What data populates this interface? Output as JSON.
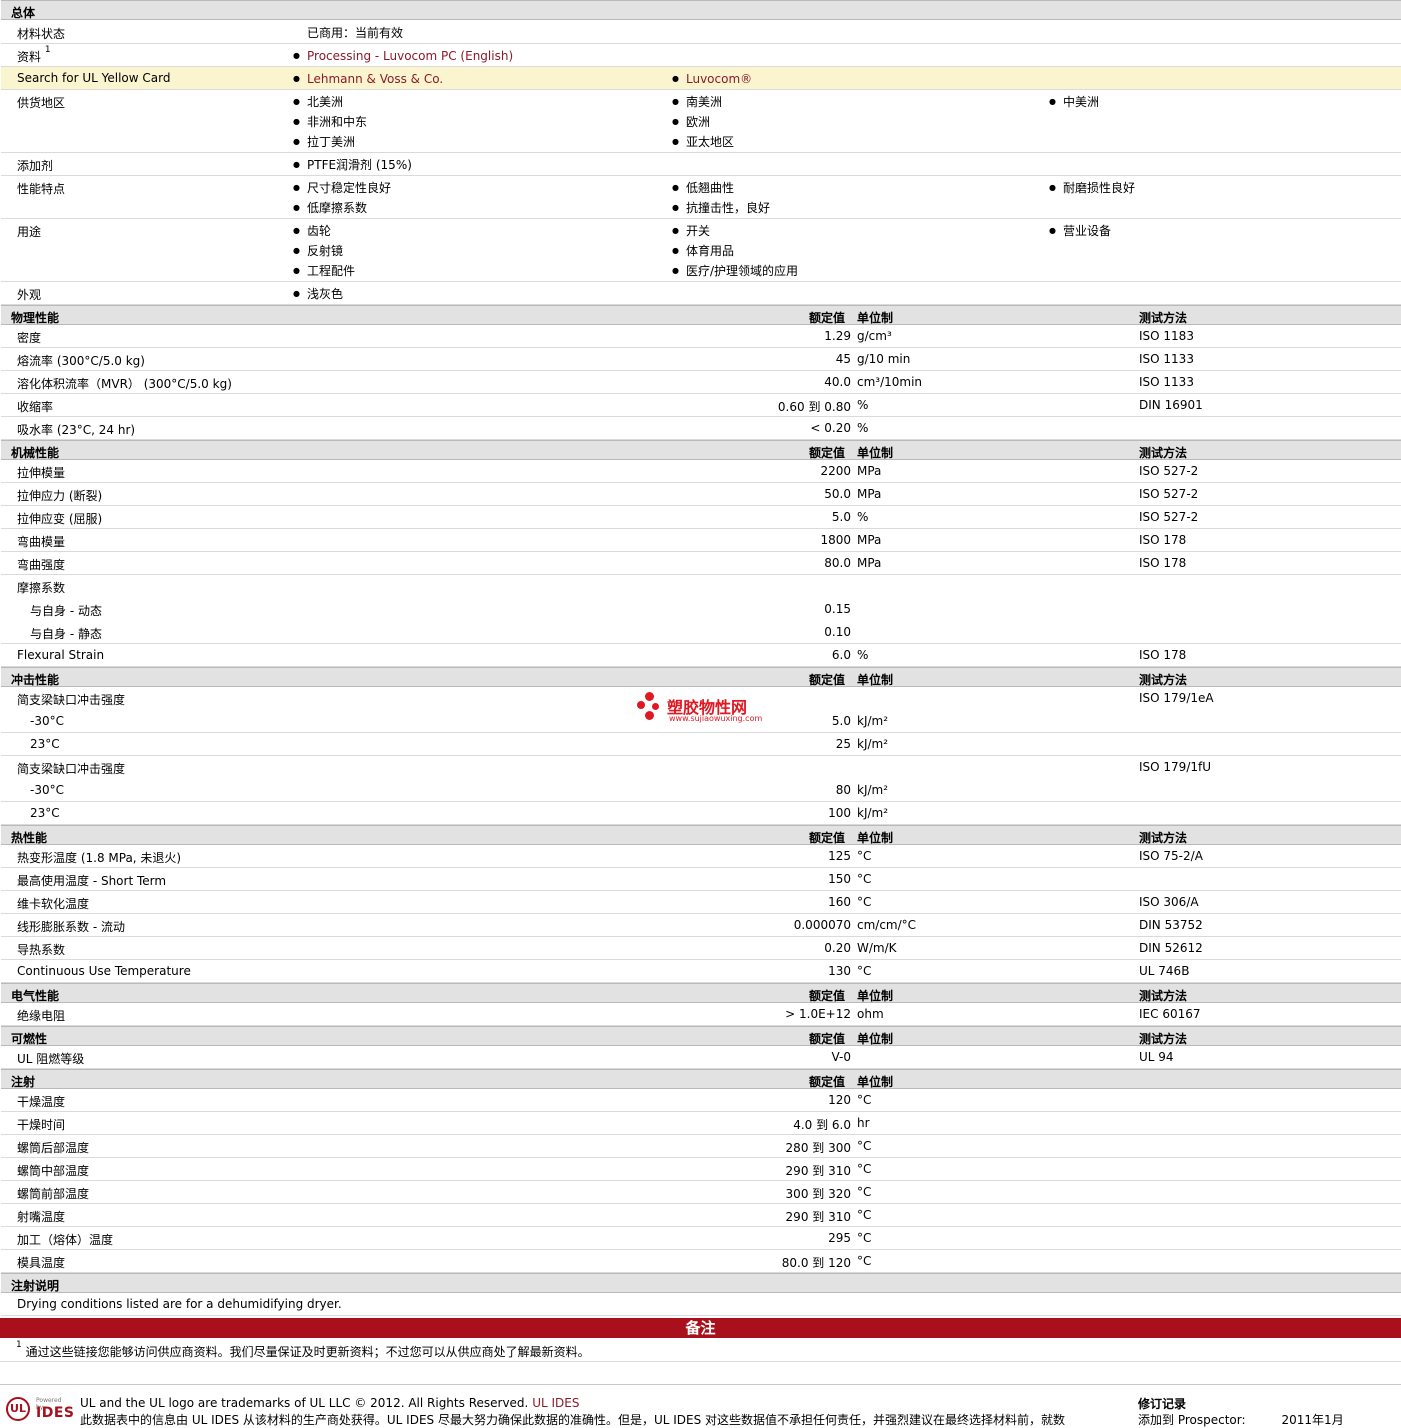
{
  "general": {
    "title": "总体",
    "rows": [
      {
        "label": "材料状态",
        "cols": [
          [
            "已商用：当前有效"
          ]
        ],
        "bullets": false
      },
      {
        "label": "资料",
        "sup": "1",
        "cols": [
          [
            "Processing - Luvocom PC (English)"
          ]
        ],
        "link": true
      },
      {
        "label": "Search for UL Yellow Card",
        "cols": [
          [
            "Lehmann & Voss & Co."
          ],
          [
            "Luvocom®"
          ]
        ],
        "link": true,
        "highlight": true
      },
      {
        "label": "供货地区",
        "cols": [
          [
            "北美洲",
            "非洲和中东",
            "拉丁美洲"
          ],
          [
            "南美洲",
            "欧洲",
            "亚太地区"
          ],
          [
            "中美洲"
          ]
        ]
      },
      {
        "label": "添加剂",
        "cols": [
          [
            "PTFE润滑剂 (15%)"
          ]
        ]
      },
      {
        "label": "性能特点",
        "cols": [
          [
            "尺寸稳定性良好",
            "低摩擦系数"
          ],
          [
            "低翘曲性",
            "抗撞击性，良好"
          ],
          [
            "耐磨损性良好"
          ]
        ]
      },
      {
        "label": "用途",
        "cols": [
          [
            "齿轮",
            "反射镜",
            "工程配件"
          ],
          [
            "开关",
            "体育用品",
            "医疗/护理领域的应用"
          ],
          [
            "营业设备"
          ]
        ]
      },
      {
        "label": "外观",
        "cols": [
          [
            "浅灰色"
          ]
        ]
      }
    ]
  },
  "headers": {
    "nominal": "额定值",
    "unit": "单位制",
    "method": "测试方法"
  },
  "sections": [
    {
      "title": "物理性能",
      "show_headers": true,
      "rows": [
        {
          "label": "密度",
          "nominal": "1.29",
          "unit": "g/cm³",
          "method": "ISO 1183"
        },
        {
          "label": "熔流率 (300°C/5.0 kg)",
          "nominal": "45",
          "unit": "g/10 min",
          "method": "ISO 1133"
        },
        {
          "label": "溶化体积流率（MVR） (300°C/5.0 kg)",
          "nominal": "40.0",
          "unit": "cm³/10min",
          "method": "ISO 1133"
        },
        {
          "label": "收缩率",
          "nominal": "0.60 到  0.80",
          "unit": "%",
          "method": "DIN 16901"
        },
        {
          "label": "吸水率 (23°C, 24 hr)",
          "nominal": "< 0.20",
          "unit": "%",
          "method": ""
        }
      ]
    },
    {
      "title": "机械性能",
      "show_headers": true,
      "rows": [
        {
          "label": "拉伸模量",
          "nominal": "2200",
          "unit": "MPa",
          "method": "ISO 527-2"
        },
        {
          "label": "拉伸应力 (断裂)",
          "nominal": "50.0",
          "unit": "MPa",
          "method": "ISO 527-2"
        },
        {
          "label": "拉伸应变 (屈服)",
          "nominal": "5.0",
          "unit": "%",
          "method": "ISO 527-2"
        },
        {
          "label": "弯曲模量",
          "nominal": "1800",
          "unit": "MPa",
          "method": "ISO 178"
        },
        {
          "label": "弯曲强度",
          "nominal": "80.0",
          "unit": "MPa",
          "method": "ISO 178"
        },
        {
          "label": "摩擦系数",
          "nominal": "",
          "unit": "",
          "method": "",
          "nosep": true
        },
        {
          "label": "与自身  - 动态",
          "indent": true,
          "nominal": "0.15",
          "unit": "",
          "method": "",
          "nosep": true
        },
        {
          "label": "与自身  - 静态",
          "indent": true,
          "nominal": "0.10",
          "unit": "",
          "method": ""
        },
        {
          "label": "Flexural Strain",
          "nominal": "6.0",
          "unit": "%",
          "method": "ISO 178"
        }
      ]
    },
    {
      "title": "冲击性能",
      "show_headers": true,
      "rows": [
        {
          "label": "简支梁缺口冲击强度",
          "nominal": "",
          "unit": "",
          "method": "ISO 179/1eA",
          "nosep": true
        },
        {
          "label": "-30°C",
          "indent": true,
          "nominal": "5.0",
          "unit": "kJ/m²",
          "method": ""
        },
        {
          "label": "23°C",
          "indent": true,
          "nominal": "25",
          "unit": "kJ/m²",
          "method": ""
        },
        {
          "label": "简支梁缺口冲击强度",
          "nominal": "",
          "unit": "",
          "method": "ISO 179/1fU",
          "nosep": true
        },
        {
          "label": "-30°C",
          "indent": true,
          "nominal": "80",
          "unit": "kJ/m²",
          "method": ""
        },
        {
          "label": "23°C",
          "indent": true,
          "nominal": "100",
          "unit": "kJ/m²",
          "method": ""
        }
      ]
    },
    {
      "title": "热性能",
      "show_headers": true,
      "rows": [
        {
          "label": "热变形温度 (1.8 MPa, 未退火)",
          "nominal": "125",
          "unit": "°C",
          "method": "ISO 75-2/A"
        },
        {
          "label": "最高使用温度  - Short Term",
          "nominal": "150",
          "unit": "°C",
          "method": ""
        },
        {
          "label": "维卡软化温度",
          "nominal": "160",
          "unit": "°C",
          "method": "ISO 306/A"
        },
        {
          "label": "线形膨胀系数  - 流动",
          "nominal": "0.000070",
          "unit": "cm/cm/°C",
          "method": "DIN 53752"
        },
        {
          "label": "导热系数",
          "nominal": "0.20",
          "unit": "W/m/K",
          "method": "DIN 52612"
        },
        {
          "label": "Continuous Use Temperature",
          "nominal": "130",
          "unit": "°C",
          "method": "UL 746B"
        }
      ]
    },
    {
      "title": "电气性能",
      "show_headers": true,
      "rows": [
        {
          "label": "绝缘电阻",
          "nominal": "> 1.0E+12",
          "unit": "ohm",
          "method": "IEC 60167"
        }
      ]
    },
    {
      "title": "可燃性",
      "show_headers": true,
      "rows": [
        {
          "label": "UL 阻燃等级",
          "nominal": "V-0",
          "unit": "",
          "method": "UL 94"
        }
      ]
    },
    {
      "title": "注射",
      "show_headers": true,
      "show_method": false,
      "rows": [
        {
          "label": "干燥温度",
          "nominal": "120",
          "unit": "°C",
          "method": ""
        },
        {
          "label": "干燥时间",
          "nominal": "4.0 到  6.0",
          "unit": "hr",
          "method": ""
        },
        {
          "label": "螺筒后部温度",
          "nominal": "280 到  300",
          "unit": "°C",
          "method": ""
        },
        {
          "label": "螺筒中部温度",
          "nominal": "290 到  310",
          "unit": "°C",
          "method": ""
        },
        {
          "label": "螺筒前部温度",
          "nominal": "300 到  320",
          "unit": "°C",
          "method": ""
        },
        {
          "label": "射嘴温度",
          "nominal": "290 到  310",
          "unit": "°C",
          "method": ""
        },
        {
          "label": "加工（熔体）温度",
          "nominal": "295",
          "unit": "°C",
          "method": ""
        },
        {
          "label": "模具温度",
          "nominal": "80.0 到  120",
          "unit": "°C",
          "method": ""
        }
      ]
    },
    {
      "title": "注射说明",
      "show_headers": false,
      "rows": [
        {
          "label": "Drying conditions listed are for a dehumidifying dryer.",
          "nominal": "",
          "unit": "",
          "method": ""
        }
      ]
    }
  ],
  "notes": {
    "title": "备注",
    "footnote_num": "1",
    "footnote": "通过这些链接您能够访问供应商资料。我们尽量保证及时更新资料；不过您可以从供应商处了解最新资料。"
  },
  "watermark": {
    "name": "塑胶物性网",
    "url": "www.sujiaowuxing.com"
  },
  "footer": {
    "logo_ul": "UL",
    "logo_powered": "Powered by",
    "logo_ides": "IDES",
    "trademark": "UL and the UL logo are trademarks of UL LLC © 2012. All Rights Reserved.",
    "trademark_link": "UL IDES",
    "disclaimer": "此数据表中的信息由  UL IDES 从该材料的生产商处获得。UL IDES 尽最大努力确保此数据的准确性。但是，UL IDES 对这些数据值不承担任何责任，并强烈建议在最终选择材料前，就数",
    "revision_title": "修订记录",
    "revision_added": "添加到  Prospector:",
    "revision_date": "2011年1月"
  },
  "colors": {
    "section_bg": "#e2e2e2",
    "link": "#8b1a2b",
    "highlight": "#fbf5cf",
    "notes_bar": "#a8101c"
  }
}
